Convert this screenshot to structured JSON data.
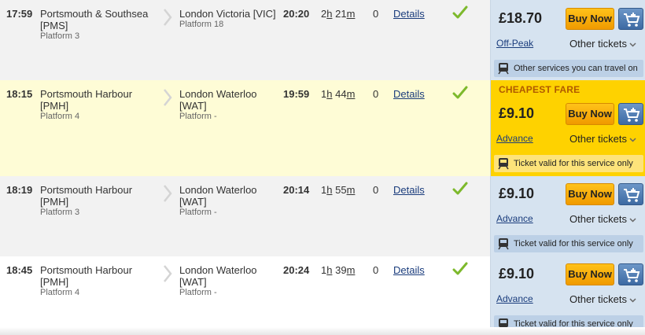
{
  "journeys": [
    {
      "dep_time": "17:59",
      "from_name": "Portsmouth & Southsea",
      "from_code": "[PMS]",
      "from_platform": "Platform 3",
      "to_name": "London Victoria [VIC]",
      "to_code": "",
      "to_platform": "Platform 18",
      "arr_time": "20:20",
      "duration_h": "2",
      "duration_h_unit": "h",
      "duration_m": "21",
      "duration_m_unit": "m",
      "changes": "0",
      "details_label": "Details",
      "fare_label": "",
      "price": "£18.70",
      "buy_label": "Buy Now",
      "fare_type": "Off-Peak",
      "other_tickets": "Other tickets",
      "notice": "Other services you can travel on",
      "notice_style": "blue"
    },
    {
      "dep_time": "18:15",
      "from_name": "Portsmouth Harbour",
      "from_code": "[PMH]",
      "from_platform": "Platform 4",
      "to_name": "London Waterloo",
      "to_code": "[WAT]",
      "to_platform": "Platform -",
      "arr_time": "19:59",
      "duration_h": "1",
      "duration_h_unit": "h",
      "duration_m": "44",
      "duration_m_unit": "m",
      "changes": "0",
      "details_label": "Details",
      "fare_label": "CHEAPEST FARE",
      "price": "£9.10",
      "buy_label": "Buy Now",
      "fare_type": "Advance",
      "other_tickets": "Other tickets",
      "notice": "Ticket valid for this service only",
      "notice_style": "yellow"
    },
    {
      "dep_time": "18:19",
      "from_name": "Portsmouth Harbour",
      "from_code": "[PMH]",
      "from_platform": "Platform 3",
      "to_name": "London Waterloo",
      "to_code": "[WAT]",
      "to_platform": "Platform -",
      "arr_time": "20:14",
      "duration_h": "1",
      "duration_h_unit": "h",
      "duration_m": "55",
      "duration_m_unit": "m",
      "changes": "0",
      "details_label": "Details",
      "fare_label": "",
      "price": "£9.10",
      "buy_label": "Buy Now",
      "fare_type": "Advance",
      "other_tickets": "Other tickets",
      "notice": "Ticket valid for this service only",
      "notice_style": "blue"
    },
    {
      "dep_time": "18:45",
      "from_name": "Portsmouth Harbour",
      "from_code": "[PMH]",
      "from_platform": "Platform 4",
      "to_name": "London Waterloo",
      "to_code": "[WAT]",
      "to_platform": "Platform -",
      "arr_time": "20:24",
      "duration_h": "1",
      "duration_h_unit": "h",
      "duration_m": "39",
      "duration_m_unit": "m",
      "changes": "0",
      "details_label": "Details",
      "fare_label": "",
      "price": "£9.10",
      "buy_label": "Buy Now",
      "fare_type": "Advance",
      "other_tickets": "Other tickets",
      "notice": "Ticket valid for this service only",
      "notice_style": "blue"
    }
  ],
  "icons": {
    "status": "check-icon",
    "cart": "shopping-cart-icon",
    "notice": "train-icon",
    "dropdown": "chevron-down-icon",
    "separator": "chevron-right-icon"
  },
  "colors": {
    "accent_button": "#f5a800",
    "cheapest_fare": "#fed200",
    "fare_panel": "#d6e3f0",
    "link": "#1a3c7c",
    "tick": "#7db92c"
  }
}
